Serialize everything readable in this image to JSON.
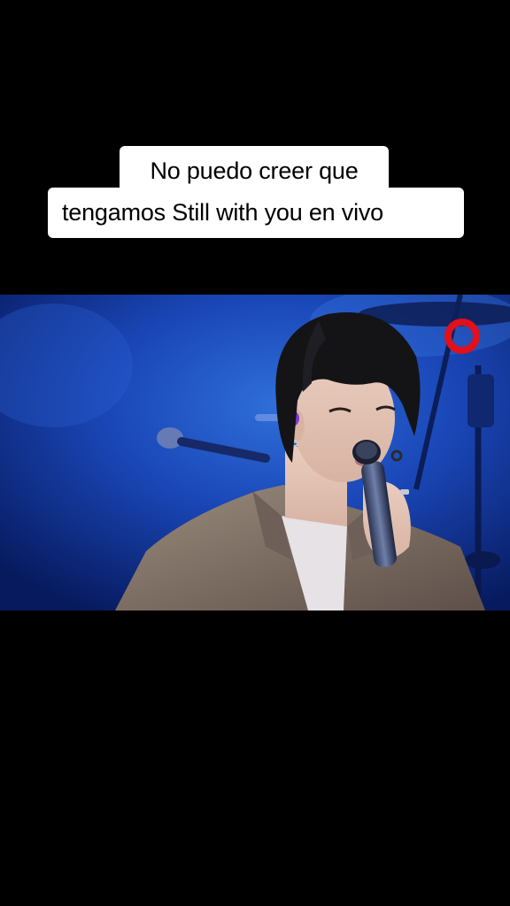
{
  "caption": {
    "line1": "No puedo creer que",
    "line2": "tengamos Still with you en vivo"
  },
  "video": {
    "description_icon": "record-ring-icon",
    "colors": {
      "stage_blue": "#0c2a8a",
      "stage_blue_light": "#2f6fd9",
      "ring_red": "#e0101c",
      "jacket": "#8a7a6e",
      "hair": "#141416"
    }
  }
}
